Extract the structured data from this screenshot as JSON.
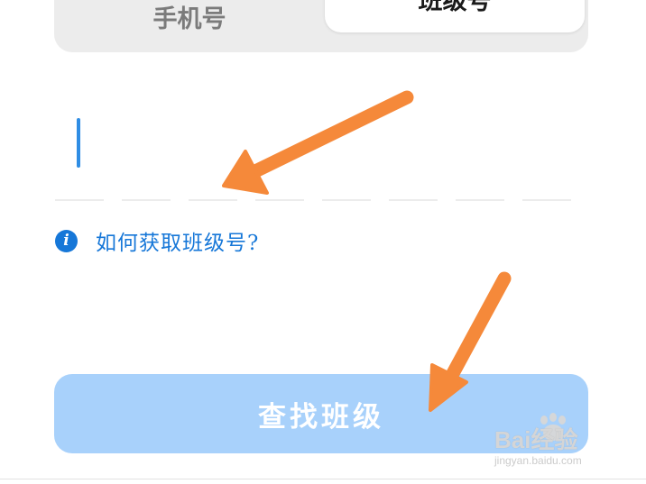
{
  "tabs": {
    "phone_label": "手机号",
    "class_label": "班级号",
    "active": "班级号"
  },
  "code_input": {
    "slot_count": 8,
    "value": ""
  },
  "help_link": {
    "icon": "info-icon",
    "icon_glyph": "i",
    "label": "如何获取班级号?"
  },
  "find_button": {
    "label": "查找班级"
  },
  "watermark": {
    "text": "Bai经验",
    "url": "jingyan.baidu.com"
  },
  "colors": {
    "accent_blue": "#1677d8",
    "cursor_blue": "#2f8de4",
    "button_bg": "#a8d1fb",
    "tab_track": "#ececec",
    "arrow_orange": "#f5893a"
  }
}
